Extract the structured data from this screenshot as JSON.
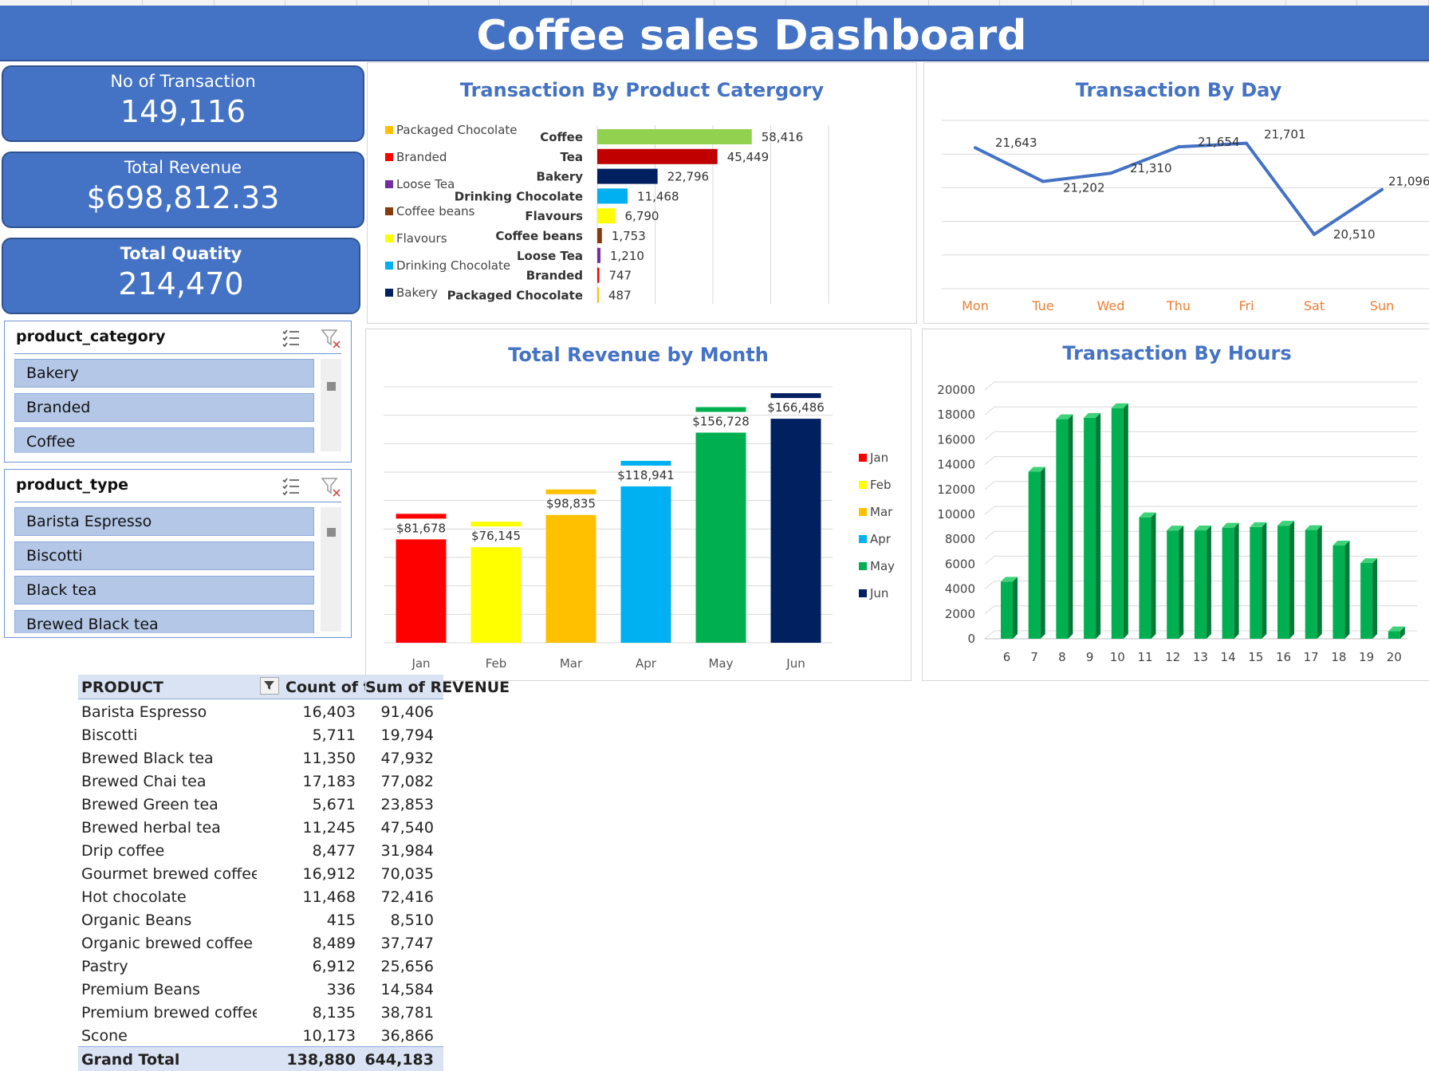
{
  "dashboard": {
    "title": "Coffee sales Dashboard"
  },
  "kpis": [
    {
      "label": "No of Transaction",
      "value": "149,116"
    },
    {
      "label": "Total Revenue",
      "value": "$698,812.33"
    },
    {
      "label": "Total Quatity",
      "value": "214,470"
    }
  ],
  "slicers": {
    "category": {
      "title": "product_category",
      "items": [
        "Bakery",
        "Branded",
        "Coffee"
      ]
    },
    "type": {
      "title": "product_type",
      "items": [
        "Barista Espresso",
        "Biscotti",
        "Black tea",
        "Brewed Black tea"
      ]
    },
    "multi_select_icon": "multi-select-icon",
    "clear_filter_icon": "clear-filter-icon"
  },
  "charts": {
    "category_title": "Transaction By Product Catergory",
    "day_title": "Transaction By Day",
    "month_title": "Total Revenue by Month",
    "hours_title": "Transaction By Hours"
  },
  "chart_data": [
    {
      "type": "bar",
      "title": "Transaction By Product Catergory",
      "orientation": "horizontal",
      "categories": [
        "Coffee",
        "Tea",
        "Bakery",
        "Drinking Chocolate",
        "Flavours",
        "Coffee beans",
        "Loose Tea",
        "Branded",
        "Packaged Chocolate"
      ],
      "values": [
        58416,
        45449,
        22796,
        11468,
        6790,
        1753,
        1210,
        747,
        487
      ],
      "value_labels": [
        "58,416",
        "45,449",
        "22,796",
        "11,468",
        "6,790",
        "1,753",
        "1,210",
        "747",
        "487"
      ],
      "colors": [
        "#92d050",
        "#c00000",
        "#002060",
        "#00b0f0",
        "#ffff00",
        "#843c0c",
        "#7030a0",
        "#ff0000",
        "#ffc000"
      ],
      "legend": [
        "Packaged Chocolate",
        "Branded",
        "Loose Tea",
        "Coffee beans",
        "Flavours",
        "Drinking Chocolate",
        "Bakery"
      ],
      "legend_colors": [
        "#ffc000",
        "#ff0000",
        "#7030a0",
        "#843c0c",
        "#ffff00",
        "#00b0f0",
        "#002060"
      ],
      "legend_position": "left",
      "xlim": [
        0,
        80000
      ],
      "grid": true
    },
    {
      "type": "line",
      "title": "Transaction By Day",
      "categories": [
        "Mon",
        "Tue",
        "Wed",
        "Thu",
        "Fri",
        "Sat",
        "Sun"
      ],
      "values": [
        21643,
        21202,
        21310,
        21654,
        21701,
        20510,
        21096
      ],
      "value_labels": [
        "21,643",
        "21,202",
        "21,310",
        "21,654",
        "21,701",
        "20,510",
        "21,096"
      ],
      "ylim": [
        19800,
        22000
      ],
      "color": "#4472c4",
      "axis_label_color": "#ed7d31",
      "grid": true
    },
    {
      "type": "bar",
      "title": "Total Revenue by Month",
      "categories": [
        "Jan",
        "Feb",
        "Mar",
        "Apr",
        "May",
        "Jun"
      ],
      "values": [
        81678,
        76145,
        98835,
        118941,
        156728,
        166486
      ],
      "value_labels": [
        "$81,678",
        "$76,145",
        "$98,835",
        "$118,941",
        "$156,728",
        "$166,486"
      ],
      "colors": [
        "#ff0000",
        "#ffff00",
        "#ffc000",
        "#00b0f0",
        "#00b050",
        "#002060"
      ],
      "legend": [
        "Jan",
        "Feb",
        "Mar",
        "Apr",
        "May",
        "Jun"
      ],
      "legend_position": "right",
      "ylim": [
        0,
        180000
      ],
      "grid": true
    },
    {
      "type": "bar",
      "title": "Transaction By Hours",
      "categories": [
        "6",
        "7",
        "8",
        "9",
        "10",
        "11",
        "12",
        "13",
        "14",
        "15",
        "16",
        "17",
        "18",
        "19",
        "20"
      ],
      "values": [
        4594,
        13428,
        17654,
        17764,
        18545,
        9766,
        8708,
        8714,
        8933,
        8979,
        9093,
        8745,
        7498,
        6092,
        603
      ],
      "ylim": [
        0,
        20000
      ],
      "yticks": [
        "0",
        "2000",
        "4000",
        "6000",
        "8000",
        "10000",
        "12000",
        "14000",
        "16000",
        "18000",
        "20000"
      ],
      "color": "#00b050",
      "grid": true
    }
  ],
  "pivot": {
    "headers": [
      "PRODUCT",
      "Count of transaction_qty",
      "Sum of REVENUE"
    ],
    "rows": [
      [
        "Barista Espresso",
        "16,403",
        "91,406"
      ],
      [
        "Biscotti",
        "5,711",
        "19,794"
      ],
      [
        "Brewed Black tea",
        "11,350",
        "47,932"
      ],
      [
        "Brewed Chai tea",
        "17,183",
        "77,082"
      ],
      [
        "Brewed Green tea",
        "5,671",
        "23,853"
      ],
      [
        "Brewed herbal tea",
        "11,245",
        "47,540"
      ],
      [
        "Drip coffee",
        "8,477",
        "31,984"
      ],
      [
        "Gourmet brewed coffee",
        "16,912",
        "70,035"
      ],
      [
        "Hot chocolate",
        "11,468",
        "72,416"
      ],
      [
        "Organic Beans",
        "415",
        "8,510"
      ],
      [
        "Organic brewed coffee",
        "8,489",
        "37,747"
      ],
      [
        "Pastry",
        "6,912",
        "25,656"
      ],
      [
        "Premium Beans",
        "336",
        "14,584"
      ],
      [
        "Premium brewed coffee",
        "8,135",
        "38,781"
      ],
      [
        "Scone",
        "10,173",
        "36,866"
      ]
    ],
    "total": [
      "Grand Total",
      "138,880",
      "644,183"
    ],
    "filter_icon": "filter-dropdown-icon"
  }
}
